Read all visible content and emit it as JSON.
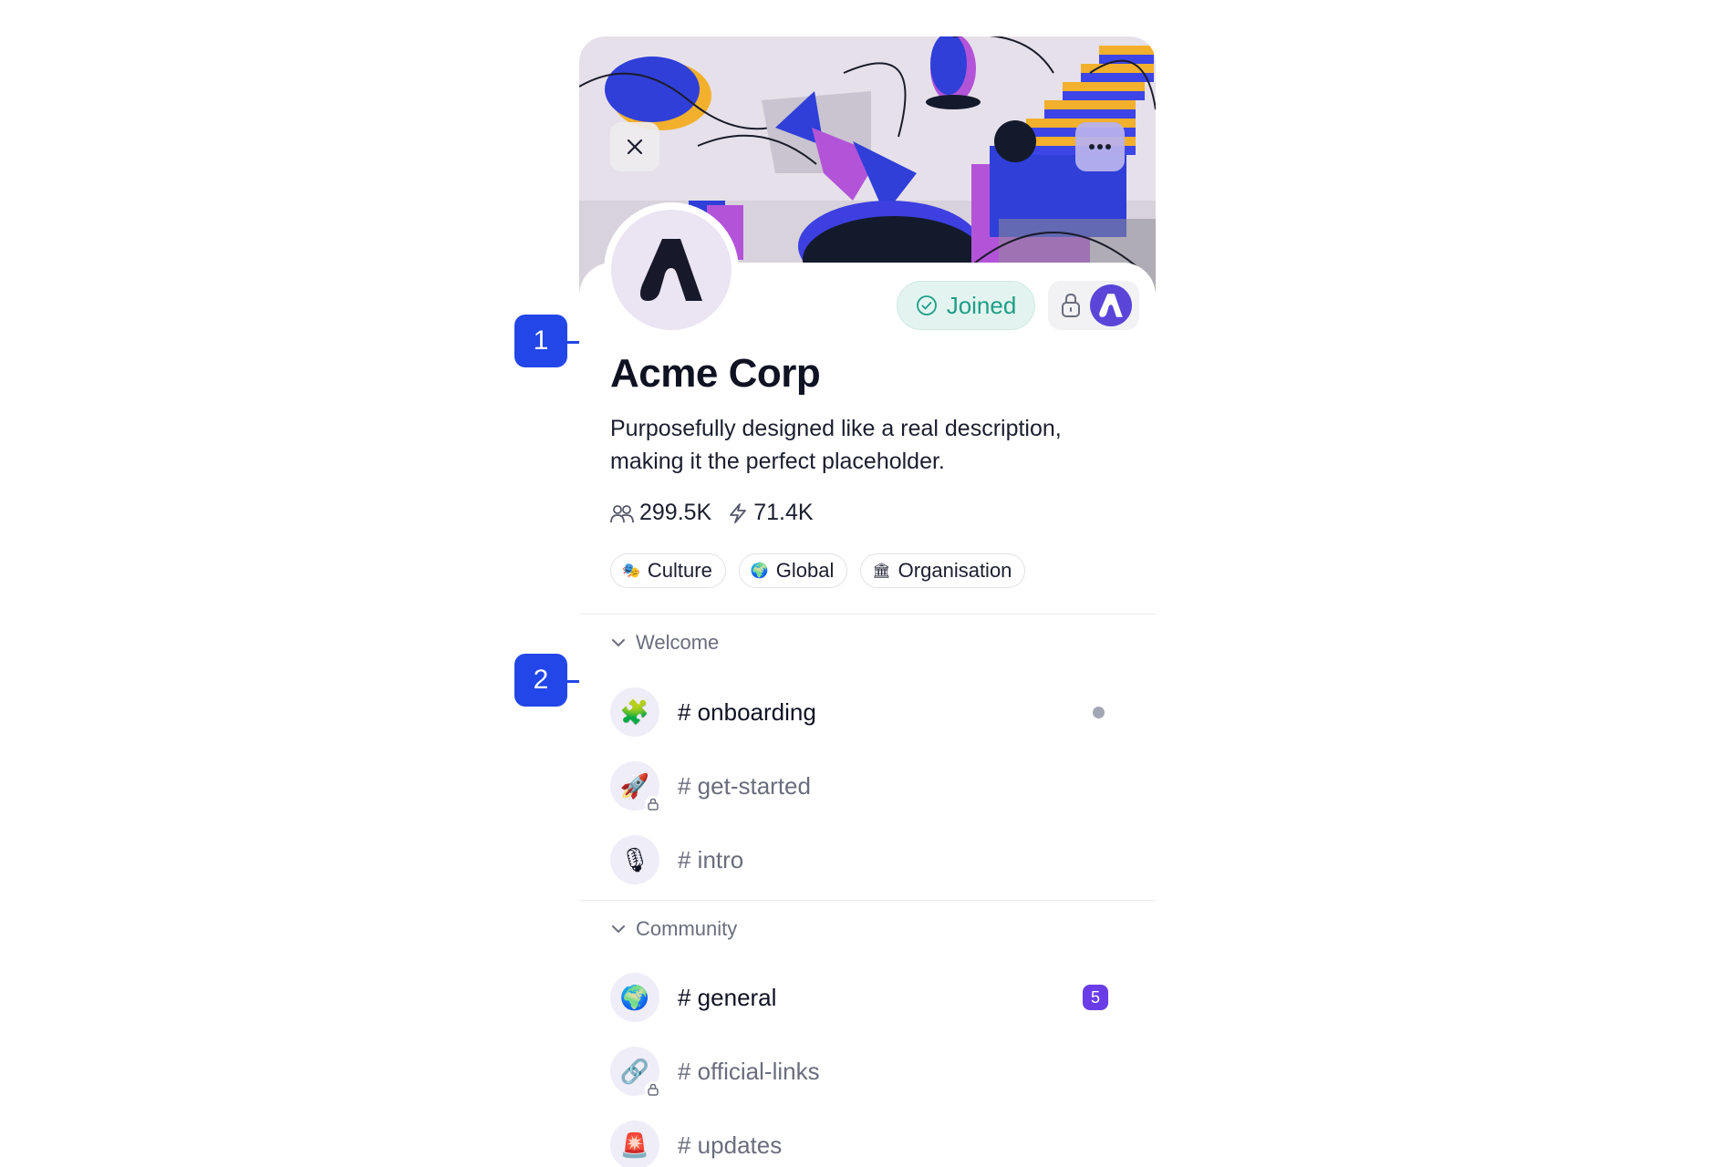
{
  "community": {
    "name": "Acme Corp",
    "description": "Purposefully designed like a real description, making it the perfect placeholder.",
    "members": "299.5K",
    "activity": "71.4K",
    "joined_label": "Joined",
    "avatar_letter": "A"
  },
  "tags": [
    {
      "label": "Culture",
      "icon": "🎭"
    },
    {
      "label": "Global",
      "icon": "🌍"
    },
    {
      "label": "Organisation",
      "icon": "🏛"
    }
  ],
  "sections": [
    {
      "title": "Welcome",
      "channels": [
        {
          "name": "# onboarding",
          "icon": "🧩",
          "locked": false,
          "indicator": "unread-dot"
        },
        {
          "name": "# get-started",
          "icon": "🚀",
          "locked": true
        },
        {
          "name": "# intro",
          "icon": "🎙",
          "locked": false
        }
      ]
    },
    {
      "title": "Community",
      "channels": [
        {
          "name": "# general",
          "icon": "🌍",
          "locked": false,
          "badge": "5"
        },
        {
          "name": "# official-links",
          "icon": "🔗",
          "locked": true
        },
        {
          "name": "# updates",
          "icon": "🚨",
          "locked": false
        }
      ]
    }
  ],
  "annotations": [
    "1",
    "2"
  ],
  "colors": {
    "accent": "#2246e8",
    "joined": "#1e9e86",
    "badge": "#6a3de8"
  }
}
